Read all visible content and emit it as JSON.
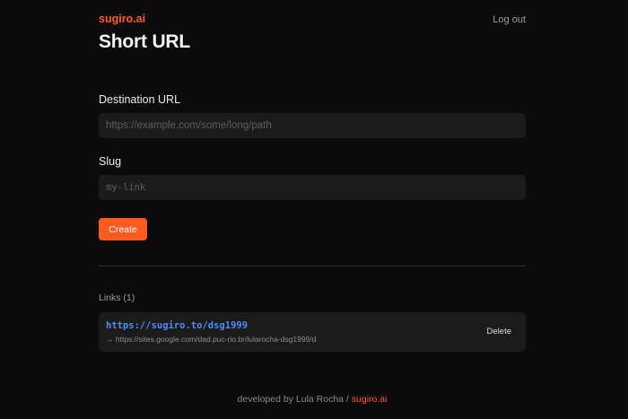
{
  "header": {
    "brand": "sugiro.ai",
    "logout_label": "Log out",
    "title": "Short URL"
  },
  "form": {
    "destination_label": "Destination URL",
    "destination_placeholder": "https://example.com/some/long/path",
    "slug_label": "Slug",
    "slug_placeholder": "my-link",
    "create_label": "Create"
  },
  "links": {
    "heading": "Links (1)",
    "items": [
      {
        "short_url": "https://sugiro.to/dsg1999",
        "arrow": "→",
        "destination": "https://sites.google.com/dad.puc-rio.br/lularocha-dsg1999/d",
        "delete_label": "Delete"
      }
    ]
  },
  "footer": {
    "text": "developed by Lula Rocha /",
    "brand": "sugiro.ai"
  },
  "colors": {
    "accent": "#ff5a1f",
    "link": "#4d8ef7",
    "background": "#0b0b0b",
    "surface": "#1b1b1b"
  }
}
